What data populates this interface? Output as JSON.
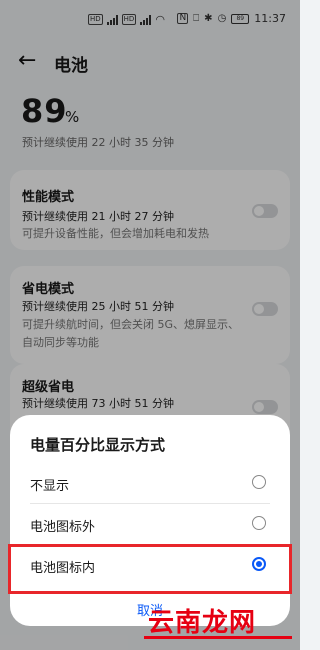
{
  "status_bar": {
    "time": "11:37",
    "battery": "89",
    "sim1": "HD",
    "sim2": "HD"
  },
  "header": {
    "title": "电池"
  },
  "battery": {
    "percent": "89",
    "unit": "%",
    "remaining": "预计继续使用 22 小时 35 分钟"
  },
  "cards": [
    {
      "title": "性能模式",
      "lines": [
        "预计继续使用 21 小时 27 分钟",
        "可提升设备性能，但会增加耗电和发热"
      ],
      "enabled": false
    },
    {
      "title": "省电模式",
      "lines": [
        "预计继续使用 25 小时 51 分钟",
        "可提升续航时间，但会关闭 5G、熄屏显示、",
        "自动同步等功能"
      ],
      "enabled": false
    },
    {
      "title": "超级省电",
      "lines": [
        "预计继续使用 73 小时 51 分钟"
      ],
      "enabled": false
    }
  ],
  "dialog": {
    "title": "电量百分比显示方式",
    "options": [
      {
        "label": "不显示",
        "selected": false
      },
      {
        "label": "电池图标外",
        "selected": false
      },
      {
        "label": "电池图标内",
        "selected": true
      }
    ],
    "cancel_label": "取消"
  },
  "watermark": {
    "text": "云南龙网"
  },
  "colors": {
    "accent": "#0a59f7",
    "highlight": "#e8262a",
    "watermark": "#e60012"
  }
}
